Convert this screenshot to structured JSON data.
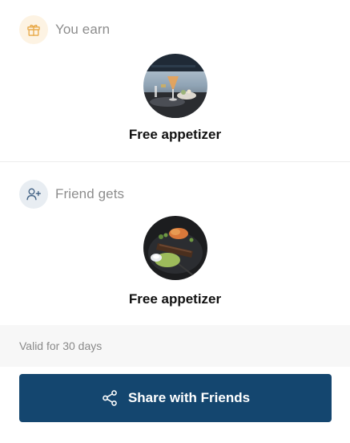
{
  "earn": {
    "header_label": "You earn",
    "reward_title": "Free appetizer",
    "icon": "gift-icon",
    "image": "cocktail-appetizer-photo"
  },
  "friend": {
    "header_label": "Friend gets",
    "reward_title": "Free appetizer",
    "icon": "add-user-icon",
    "image": "kebab-plate-photo"
  },
  "validity": {
    "text": "Valid for 30 days"
  },
  "footer": {
    "share_label": "Share with Friends",
    "share_icon": "share-icon"
  },
  "colors": {
    "primary_button": "#14466f",
    "earn_badge": "#fdf3e3",
    "earn_icon": "#e8a948",
    "friend_badge": "#e8edf2",
    "friend_icon": "#3f5f82"
  }
}
